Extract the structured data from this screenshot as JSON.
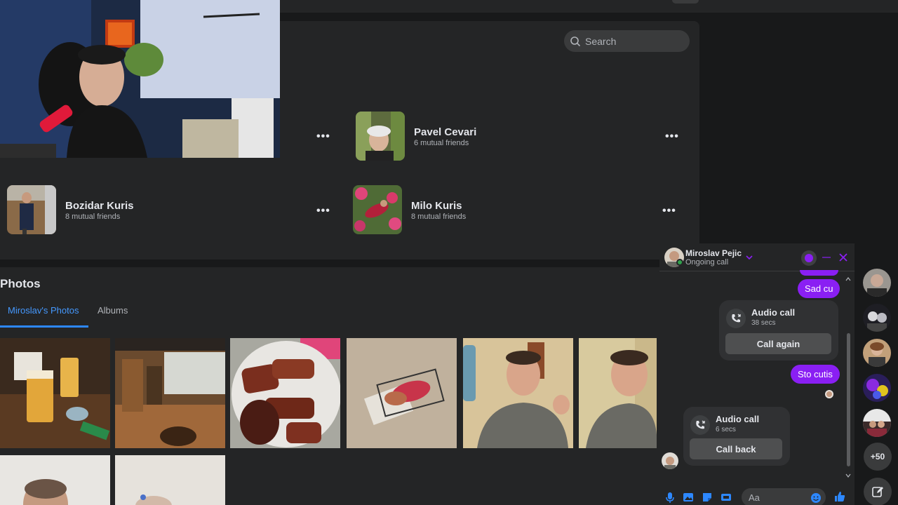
{
  "search": {
    "placeholder": "Search",
    "icon": "search-icon"
  },
  "friends": [
    {
      "name": "Pavel Cevari",
      "mutual": "6 mutual friends"
    },
    {
      "name": "Bozidar Kuris",
      "mutual": "8 mutual friends"
    },
    {
      "name": "Milo Kuris",
      "mutual": "8 mutual friends"
    }
  ],
  "more_glyph": "•••",
  "photos": {
    "title": "Photos",
    "tabs": [
      {
        "label": "Miroslav's Photos",
        "active": true
      },
      {
        "label": "Albums",
        "active": false
      }
    ]
  },
  "chat": {
    "contact_name": "Miroslav Pejic",
    "status": "Ongoing call",
    "messages": [
      {
        "type": "outgoing",
        "text": "Sad cu"
      },
      {
        "type": "call",
        "title": "Audio call",
        "duration": "38 secs",
        "action": "Call again"
      },
      {
        "type": "outgoing",
        "text": "Sto cutis"
      },
      {
        "type": "call",
        "title": "Audio call",
        "duration": "6 secs",
        "action": "Call back"
      }
    ],
    "input_placeholder": "Aa",
    "accent_color": "#8a1ff3"
  },
  "sidebar": {
    "more_count": "+50"
  }
}
